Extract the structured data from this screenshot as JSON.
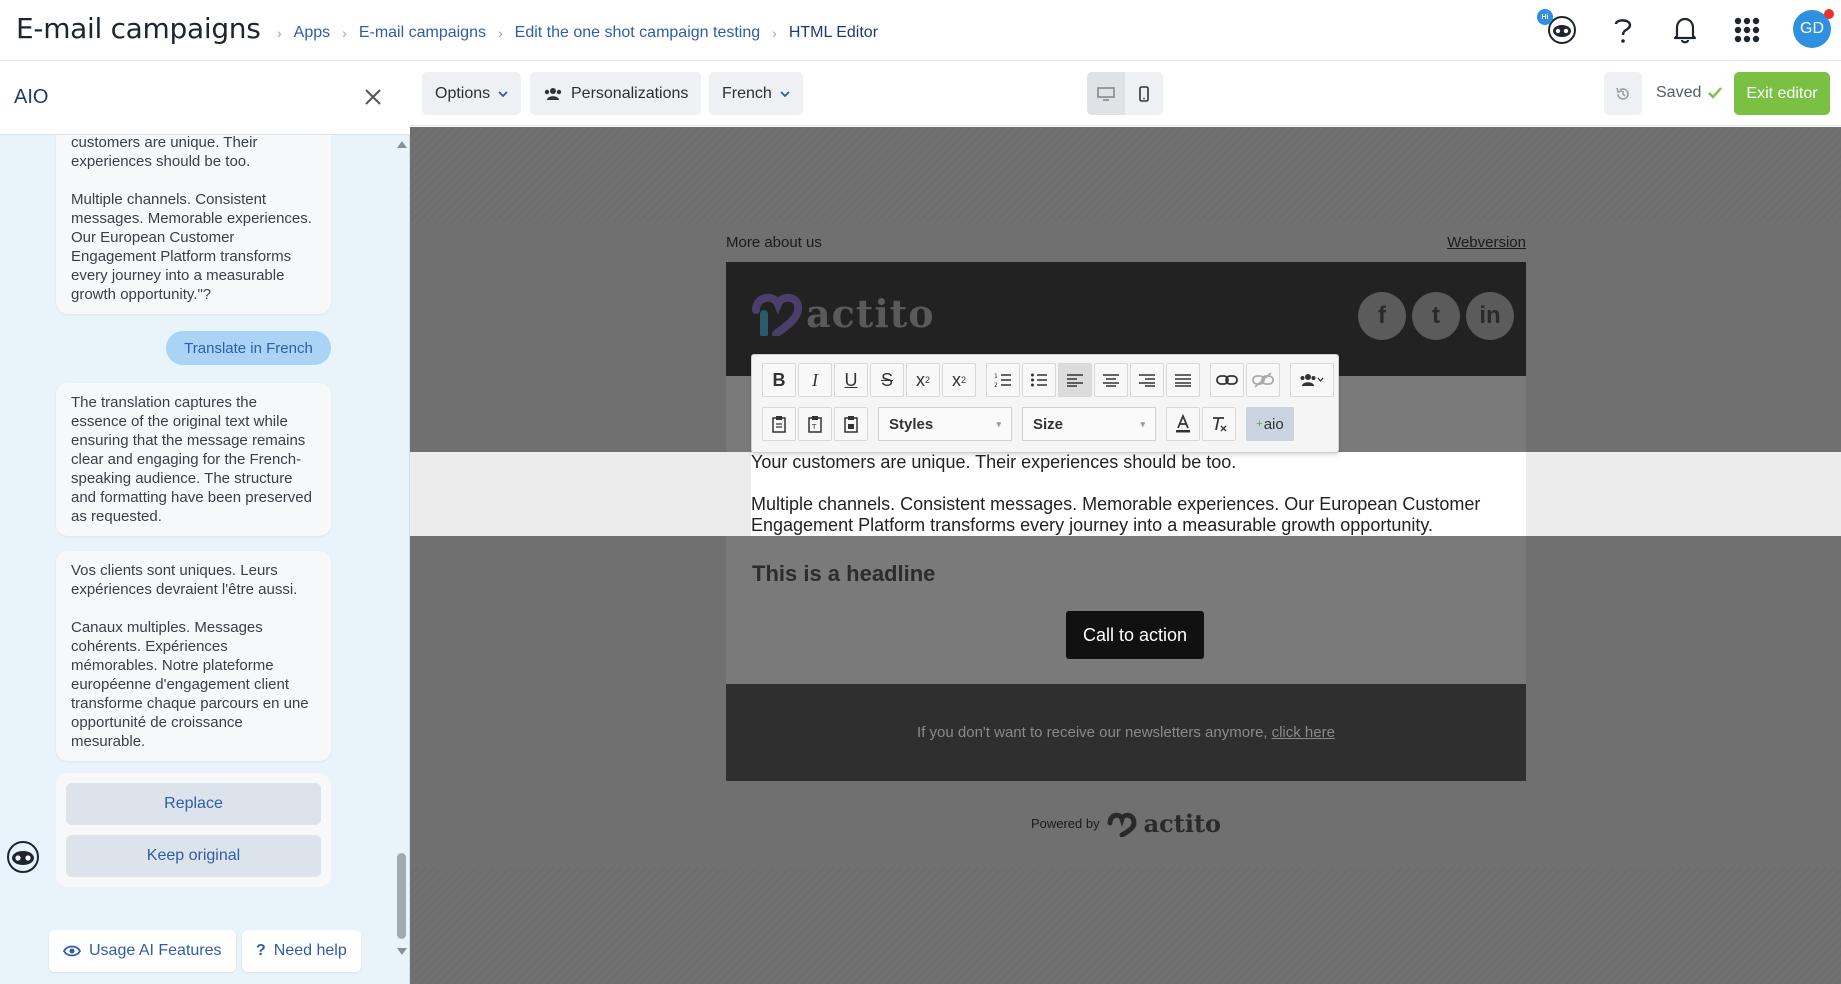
{
  "header": {
    "title": "E-mail campaigns",
    "breadcrumbs": [
      "Apps",
      "E-mail campaigns",
      "Edit the one shot campaign testing",
      "HTML Editor"
    ],
    "hi_badge": "Hi",
    "avatar_initials": "GD"
  },
  "sidebar": {
    "title": "AIO",
    "messages": {
      "first_p1": "customers are unique. Their experiences should be too.",
      "first_p2": "Multiple channels. Consistent messages. Memorable experiences. Our European Customer Engagement Platform transforms every journey into a measurable growth opportunity.\"?",
      "user": "Translate in French",
      "explanation": "The translation captures the essence of the original text while ensuring that the message remains clear and engaging for the French-speaking audience. The structure and formatting have been preserved as requested.",
      "french_p1": "Vos clients sont uniques. Leurs expériences devraient l'être aussi.",
      "french_p2": "Canaux multiples. Messages cohérents. Expériences mémorables. Notre plateforme européenne d'engagement client transforme chaque parcours en une opportunité de croissance mesurable."
    },
    "actions": {
      "replace": "Replace",
      "keep": "Keep original"
    },
    "footer": {
      "usage": "Usage AI Features",
      "help": "Need help"
    }
  },
  "toolbar": {
    "options": "Options",
    "personalizations": "Personalizations",
    "language": "French",
    "saved": "Saved",
    "exit": "Exit editor"
  },
  "rte": {
    "styles": "Styles",
    "size": "Size",
    "aio": "aio"
  },
  "email": {
    "more_about": "More about us",
    "webversion": "Webversion",
    "logo_text": "actito",
    "social": [
      "f",
      "t",
      "in"
    ],
    "body_p1": "Your customers are unique. Their experiences should be too.",
    "body_p2": "Multiple channels. Consistent messages. Memorable experiences. Our European Customer Engagement Platform transforms every journey into a measurable growth opportunity.",
    "headline": "This is a headline",
    "cta": "Call to action",
    "unsubscribe_text": "If you don't want to receive our newsletters anymore,",
    "unsubscribe_link": "click here",
    "powered_by": "Powered by",
    "powered_logo": "actito"
  },
  "colors": {
    "accent": "#2f5da8",
    "exit_green": "#7ac143",
    "avatar_blue": "#2f8fe0",
    "sidebar_bg": "#e9f3fa"
  }
}
